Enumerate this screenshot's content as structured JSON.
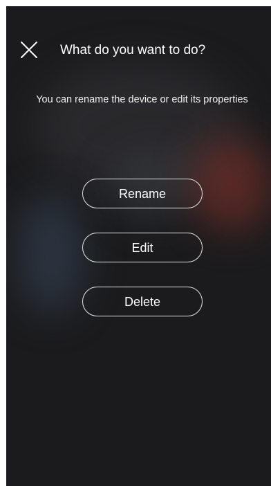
{
  "dialog": {
    "title": "What do you want to do?",
    "subtitle": "You can rename the device or edit its properties",
    "close_icon": "close-icon"
  },
  "actions": [
    {
      "label": "Rename"
    },
    {
      "label": "Edit"
    },
    {
      "label": "Delete"
    }
  ],
  "colors": {
    "background": "#1b1b1d",
    "text": "#ffffff",
    "button_border": "#e6e6e6"
  }
}
